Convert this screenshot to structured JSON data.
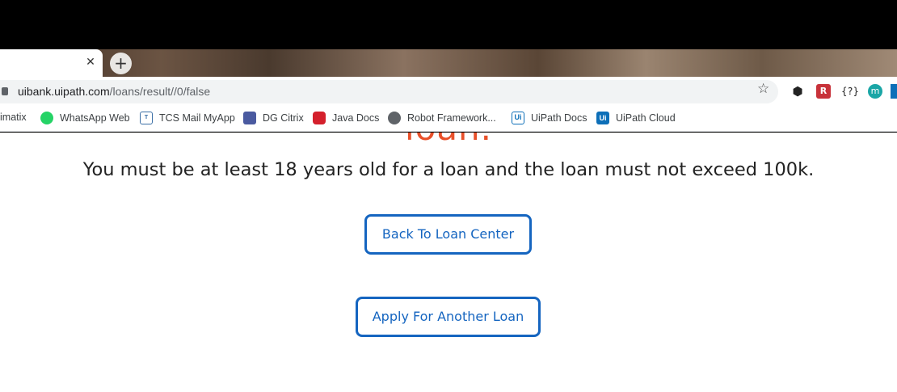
{
  "browser": {
    "tab_close": "✕",
    "new_tab": "+",
    "url_host": "uibank.uipath.com",
    "url_path": "/loans/result//0/false",
    "extensions": {
      "cube": "⬢",
      "red": "R",
      "braces": "{?}",
      "m": "m"
    }
  },
  "bookmarks": [
    {
      "label": "imatix",
      "icon": "none"
    },
    {
      "label": "WhatsApp Web",
      "icon": "whatsapp-icon",
      "color": "#25d366"
    },
    {
      "label": "TCS Mail MyApp",
      "icon": "tata-icon",
      "color": "#3a6ea5"
    },
    {
      "label": "DG Citrix",
      "icon": "lock-bag-icon",
      "color": "#4a5aa0"
    },
    {
      "label": "Java Docs",
      "icon": "oracle-icon",
      "color": "#d4202c"
    },
    {
      "label": "Robot Framework...",
      "icon": "globe-icon",
      "color": "#5f6368"
    },
    {
      "label": "UiPath Docs",
      "icon": "uipath-icon",
      "color": "#0d6fb8"
    },
    {
      "label": "UiPath Cloud",
      "icon": "uipath-icon",
      "color": "#0d6fb8"
    }
  ],
  "page": {
    "heading_tail": "loan.",
    "message": "You must be at least 18 years old for a loan and the loan must not exceed 100k.",
    "back_button": "Back To Loan Center",
    "apply_button": "Apply For Another Loan"
  },
  "colors": {
    "accent": "#1565c0",
    "heading": "#e8502a"
  }
}
